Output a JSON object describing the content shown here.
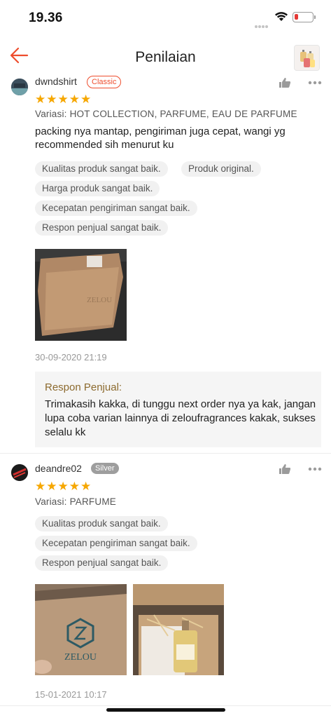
{
  "status_bar": {
    "time": "19.36",
    "battery_color": "#e53935"
  },
  "header": {
    "title": "Penilaian"
  },
  "reviews": [
    {
      "username": "dwndshirt",
      "badge": "Classic",
      "rating": 5,
      "stars": "★★★★★",
      "variant": "Variasi: HOT COLLECTION, PARFUME, EAU DE PARFUME",
      "comment": "packing nya mantap, pengiriman juga cepat, wangi yg recommended sih menurut ku",
      "tags": [
        "Kualitas produk sangat baik.",
        "Produk original.",
        "Harga produk sangat baik.",
        "Kecepatan pengiriman sangat baik.",
        "Respon penjual sangat baik."
      ],
      "photo_captions": [
        "ZELOU box on dark floor"
      ],
      "date": "30-09-2020 21:19",
      "seller_response": {
        "label": "Respon Penjual:",
        "text": "Trimakasih kakka, di tunggu next order nya ya kak, jangan lupa coba varian lainnya di zeloufragrances kakak, sukses selalu kk"
      }
    },
    {
      "username": "deandre02",
      "badge": "Silver",
      "rating": 5,
      "stars": "★★★★★",
      "variant": "Variasi: PARFUME",
      "tags": [
        "Kualitas produk sangat baik.",
        "Kecepatan pengiriman sangat baik.",
        "Respon penjual sangat baik."
      ],
      "photo_box_brand": "ZELOU",
      "date": "15-01-2021 10:17"
    }
  ],
  "colors": {
    "accent": "#ee4d2d",
    "star": "#f6a700",
    "seller_label": "#8c6a2e"
  }
}
